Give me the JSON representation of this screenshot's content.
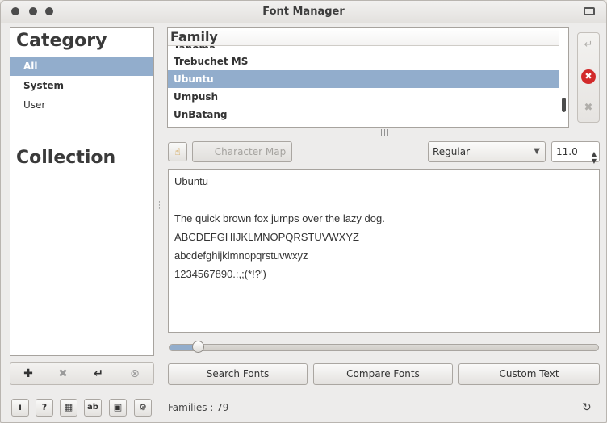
{
  "window": {
    "title": "Font Manager"
  },
  "sidebar": {
    "category_heading": "Category",
    "categories": [
      {
        "label": "All",
        "selected": true
      },
      {
        "label": "System",
        "selected": false
      },
      {
        "label": "User",
        "selected": false
      }
    ],
    "collection_heading": "Collection",
    "toolbar": [
      {
        "icon": "add-icon",
        "glyph": "✚"
      },
      {
        "icon": "remove-icon",
        "glyph": "✖"
      },
      {
        "icon": "enter-icon",
        "glyph": "↵"
      },
      {
        "icon": "clear-icon",
        "glyph": "⊗"
      }
    ]
  },
  "family_list": {
    "header": "Family",
    "partial_row": "Tahoma",
    "rows": [
      {
        "label": "Trebuchet MS",
        "selected": false
      },
      {
        "label": "Ubuntu",
        "selected": true
      },
      {
        "label": "Umpush",
        "selected": false
      },
      {
        "label": "UnBatang",
        "selected": false
      }
    ]
  },
  "right_tools": [
    {
      "icon": "enter-icon",
      "glyph": "↵"
    },
    {
      "icon": "remove-font-icon",
      "glyph": "✖"
    },
    {
      "icon": "close-icon",
      "glyph": "✖"
    }
  ],
  "preview_toolbar": {
    "charmap_label": "Character Map",
    "style_value": "Regular",
    "size_value": "11.0"
  },
  "preview": {
    "lines": [
      "Ubuntu",
      "",
      "The quick brown fox jumps over the lazy dog.",
      "ABCDEFGHIJKLMNOPQRSTUVWXYZ",
      "abcdefghijklmnopqrstuvwxyz",
      "1234567890.:,;(*!?')"
    ]
  },
  "slider": {
    "value_fraction": 0.07
  },
  "buttons": {
    "search_fonts": "Search Fonts",
    "compare_fonts": "Compare Fonts",
    "custom_text": "Custom Text"
  },
  "status": {
    "text": "Families : 79"
  },
  "bottom_tools": [
    {
      "icon": "info-icon",
      "glyph": "i"
    },
    {
      "icon": "speech-icon",
      "glyph": "?"
    },
    {
      "icon": "font-config-icon",
      "glyph": "▦"
    },
    {
      "icon": "rename-icon",
      "glyph": "ab"
    },
    {
      "icon": "save-icon",
      "glyph": "▣"
    },
    {
      "icon": "settings-icon",
      "glyph": "⚙"
    }
  ],
  "colors": {
    "selection": "#92adcc",
    "remove_red": "#d22a2a"
  }
}
